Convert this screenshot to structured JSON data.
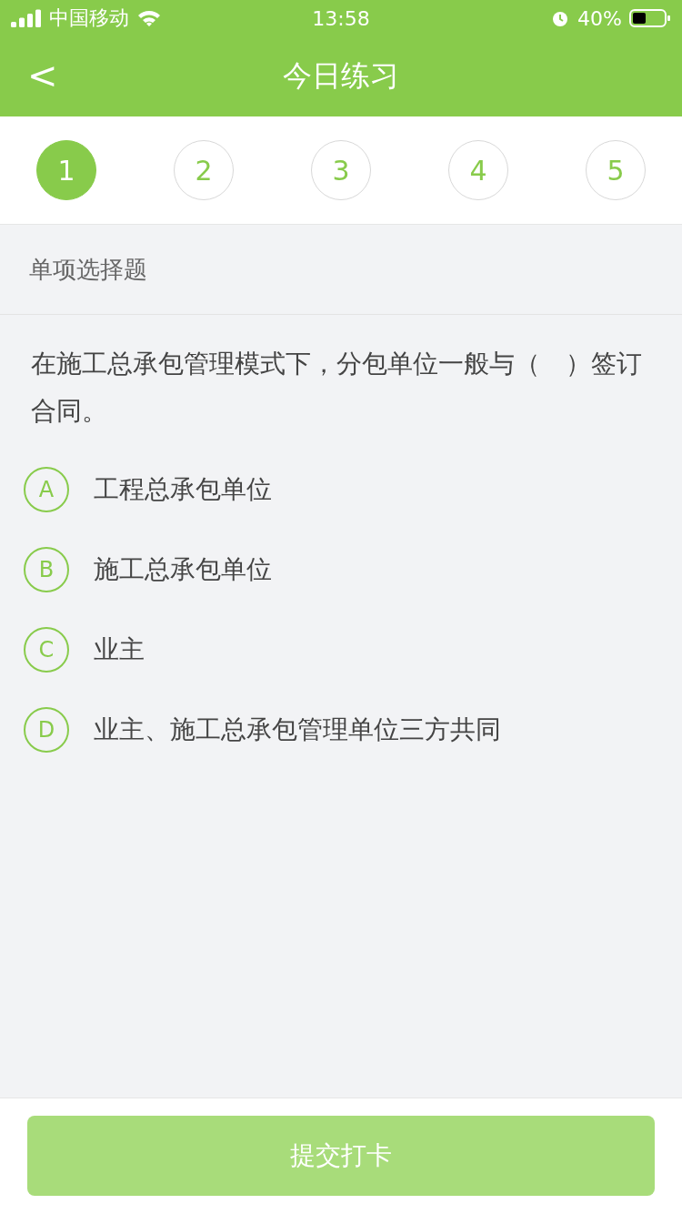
{
  "status_bar": {
    "carrier": "中国移动",
    "time": "13:58",
    "battery": "40%"
  },
  "header": {
    "back": "<",
    "title": "今日练习"
  },
  "steps": [
    {
      "label": "1",
      "selected": true
    },
    {
      "label": "2",
      "selected": false
    },
    {
      "label": "3",
      "selected": false
    },
    {
      "label": "4",
      "selected": false
    },
    {
      "label": "5",
      "selected": false
    }
  ],
  "question_type": "单项选择题",
  "question": "在施工总承包管理模式下，分包单位一般与（　）签订合同。",
  "options": [
    {
      "letter": "A",
      "text": "工程总承包单位",
      "selected": false
    },
    {
      "letter": "B",
      "text": "施工总承包单位",
      "selected": false
    },
    {
      "letter": "C",
      "text": "业主",
      "selected": false
    },
    {
      "letter": "D",
      "text": "业主、施工总承包管理单位三方共同",
      "selected": false
    }
  ],
  "submit": {
    "label": "提交打卡",
    "disabled": true
  }
}
